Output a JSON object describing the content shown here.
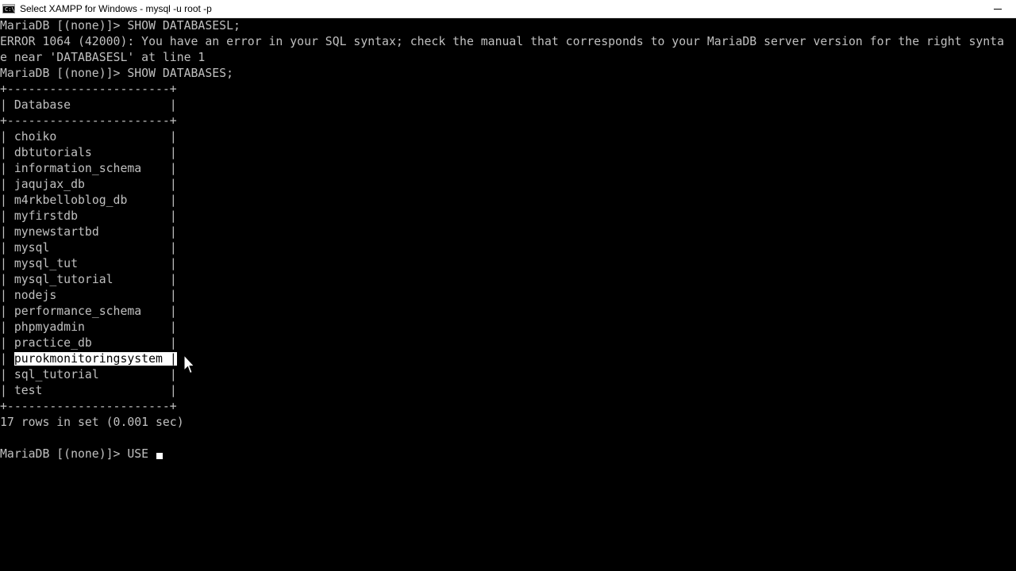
{
  "window": {
    "title": "Select XAMPP for Windows - mysql  -u root -p",
    "app_icon_glyph": "C:\\"
  },
  "console": {
    "lines": [
      "MariaDB [(none)]> SHOW DATABASESL;",
      "ERROR 1064 (42000): You have an error in your SQL syntax; check the manual that corresponds to your MariaDB server version for the right synta",
      "e near 'DATABASESL' at line 1",
      "MariaDB [(none)]> SHOW DATABASES;",
      "+-----------------------+",
      "| Database              |",
      "+-----------------------+"
    ],
    "rows": [
      "choiko",
      "dbtutorials",
      "information_schema",
      "jaqujax_db",
      "m4rkbelloblog_db",
      "myfirstdb",
      "mynewstartbd",
      "mysql",
      "mysql_tut",
      "mysql_tutorial",
      "nodejs",
      "performance_schema",
      "phpmyadmin",
      "practice_db",
      "purokmonitoringsystem",
      "sql_tutorial",
      "test"
    ],
    "selected_row": "purokmonitoringsystem",
    "table_border": "+-----------------------+",
    "summary": "17 rows in set (0.001 sec)",
    "prompt": "MariaDB [(none)]> USE "
  },
  "colors": {
    "background": "#000000",
    "text": "#c0c0c0",
    "selection_bg": "#ffffff",
    "selection_text": "#000000"
  },
  "icons": {
    "app": "console-icon",
    "minimize": "minimize-icon",
    "cursor": "mouse-pointer-icon"
  }
}
